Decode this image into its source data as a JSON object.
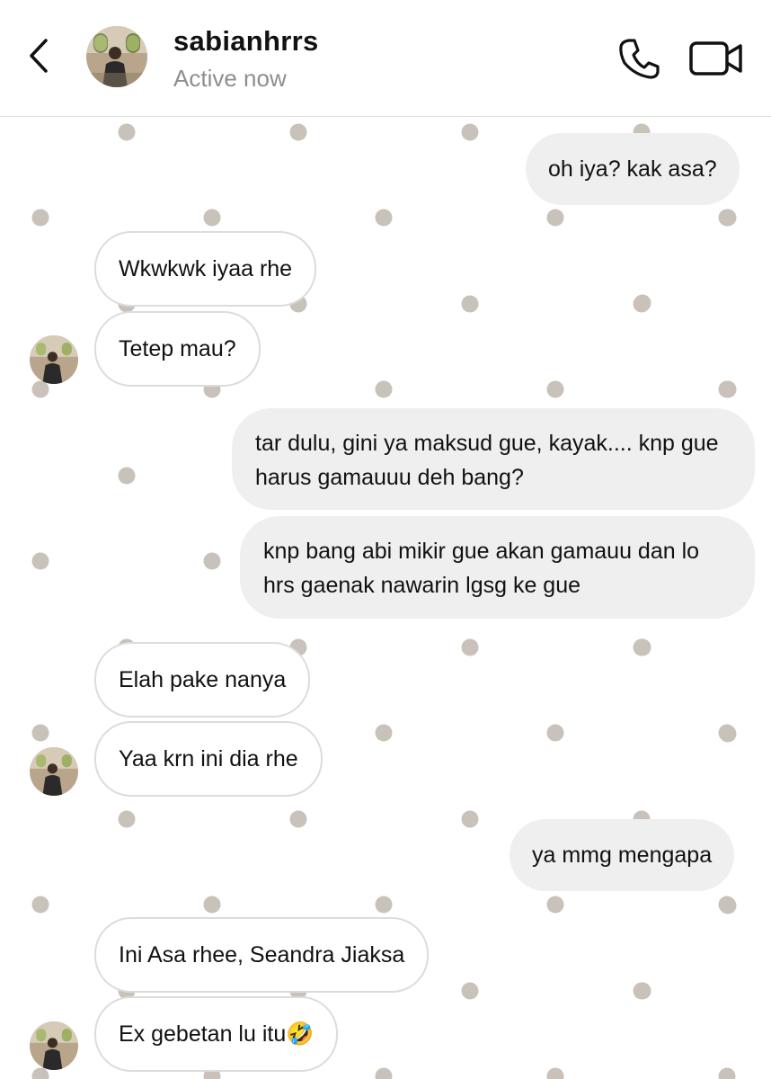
{
  "header": {
    "username": "sabianhrrs",
    "status": "Active now"
  },
  "messages": [
    {
      "from": "me",
      "text": "oh iya? kak asa?"
    },
    {
      "from": "them",
      "text": "Wkwkwk iyaa rhe"
    },
    {
      "from": "them",
      "text": "Tetep mau?"
    },
    {
      "from": "me",
      "text": "tar dulu, gini ya maksud gue, kayak.... knp gue harus gamauuu deh bang?"
    },
    {
      "from": "me",
      "text": "knp bang abi mikir gue akan gamauu dan lo hrs gaenak nawarin lgsg ke gue"
    },
    {
      "from": "them",
      "text": "Elah pake nanya"
    },
    {
      "from": "them",
      "text": "Yaa krn ini dia rhe"
    },
    {
      "from": "me",
      "text": "ya mmg mengapa"
    },
    {
      "from": "them",
      "text": "Ini Asa rhee, Seandra Jiaksa"
    },
    {
      "from": "them",
      "text": "Ex gebetan lu itu🤣"
    }
  ],
  "colors": {
    "outgoing_bubble": "#efefef",
    "incoming_border": "#dcdcdc",
    "dot": "#c8c2bb",
    "status_text": "#8e8e8e"
  },
  "icons": [
    "back-chevron-icon",
    "phone-icon",
    "video-camera-icon"
  ]
}
